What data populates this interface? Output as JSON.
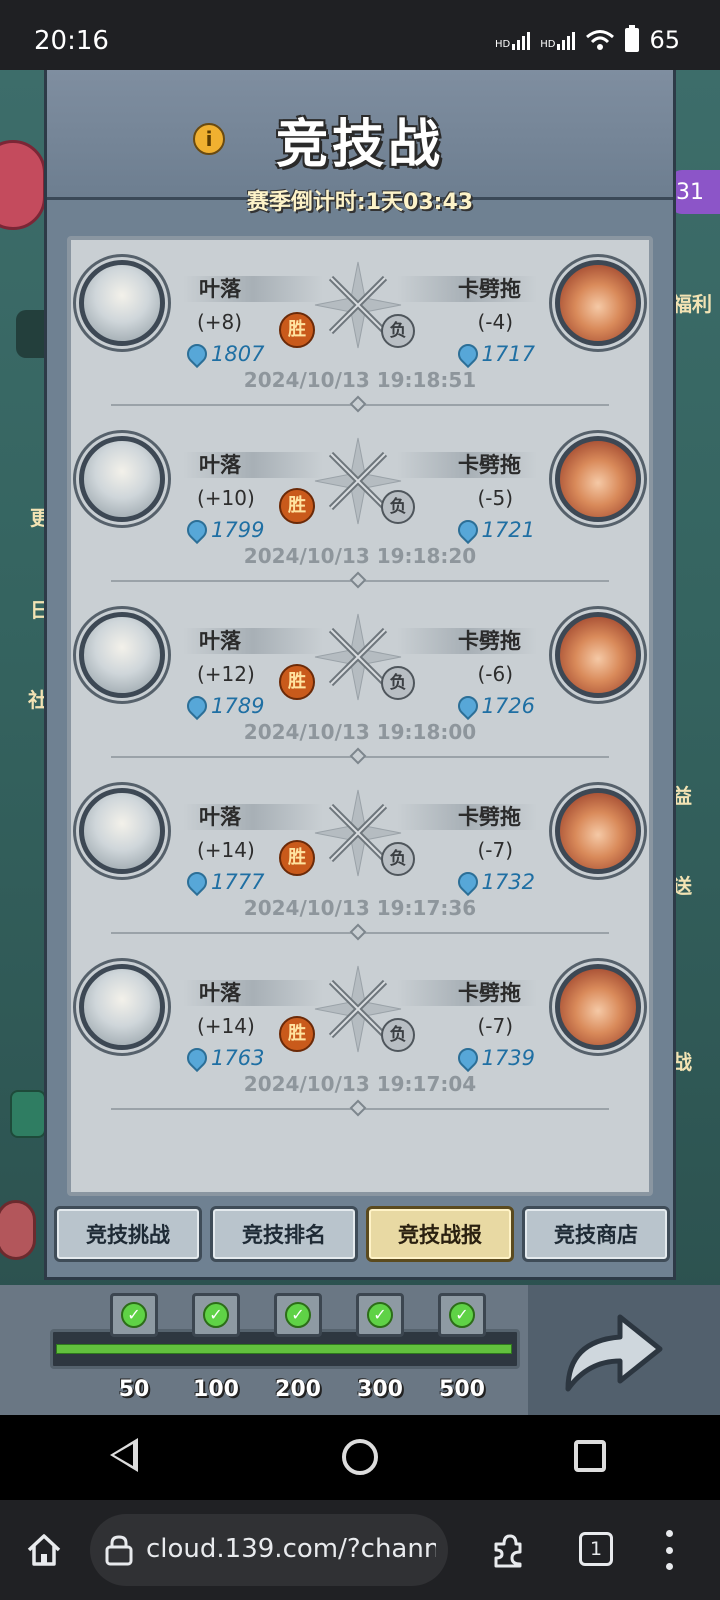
{
  "status_bar": {
    "time": "20:16",
    "network_1": "HD",
    "network_2": "HD",
    "battery": "65"
  },
  "side": {
    "right_badge": "31",
    "right_label_1": "福利",
    "right_label_2": "益",
    "right_label_3": "送",
    "right_label_4": "战",
    "left_label_1": "更",
    "left_label_2": "日",
    "left_label_3": "社"
  },
  "header": {
    "title": "竞技战",
    "countdown": "赛季倒计时:1天03:43"
  },
  "records": [
    {
      "left_name": "叶落",
      "left_delta": "(+8)",
      "left_score": "1807",
      "right_name": "卡劈拖",
      "right_delta": "(-4)",
      "right_score": "1717",
      "win_label": "胜",
      "lose_label": "负",
      "timestamp": "2024/10/13  19:18:51"
    },
    {
      "left_name": "叶落",
      "left_delta": "(+10)",
      "left_score": "1799",
      "right_name": "卡劈拖",
      "right_delta": "(-5)",
      "right_score": "1721",
      "win_label": "胜",
      "lose_label": "负",
      "timestamp": "2024/10/13  19:18:20"
    },
    {
      "left_name": "叶落",
      "left_delta": "(+12)",
      "left_score": "1789",
      "right_name": "卡劈拖",
      "right_delta": "(-6)",
      "right_score": "1726",
      "win_label": "胜",
      "lose_label": "负",
      "timestamp": "2024/10/13  19:18:00"
    },
    {
      "left_name": "叶落",
      "left_delta": "(+14)",
      "left_score": "1777",
      "right_name": "卡劈拖",
      "right_delta": "(-7)",
      "right_score": "1732",
      "win_label": "胜",
      "lose_label": "负",
      "timestamp": "2024/10/13  19:17:36"
    },
    {
      "left_name": "叶落",
      "left_delta": "(+14)",
      "left_score": "1763",
      "right_name": "卡劈拖",
      "right_delta": "(-7)",
      "right_score": "1739",
      "win_label": "胜",
      "lose_label": "负",
      "timestamp": "2024/10/13  19:17:04"
    }
  ],
  "tabs": [
    {
      "label": "竞技挑战",
      "active": false
    },
    {
      "label": "竞技排名",
      "active": false
    },
    {
      "label": "竞技战报",
      "active": true
    },
    {
      "label": "竞技商店",
      "active": false
    }
  ],
  "progress": {
    "fraction": 1.0,
    "milestones": [
      "50",
      "100",
      "200",
      "300",
      "500"
    ],
    "check_mark": "✓"
  },
  "browser": {
    "url": "cloud.139.com/?chann",
    "tab_count": "1"
  },
  "colors": {
    "win": "#c95a1b",
    "score": "#1f6fa3",
    "progress": "#62c13e"
  }
}
